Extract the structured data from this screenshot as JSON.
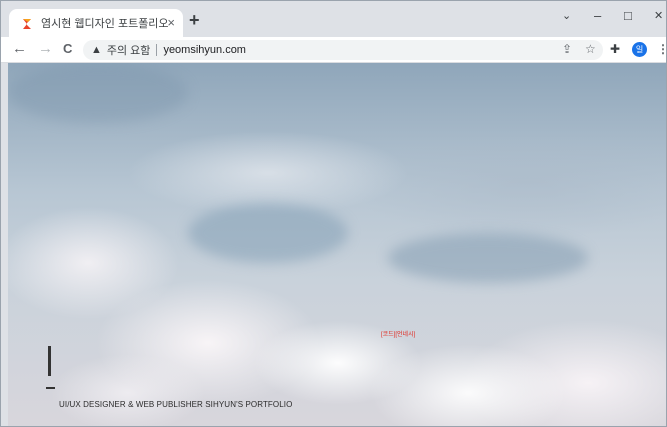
{
  "browser": {
    "tab": {
      "title": "염시현 웹디자인 포트폴리오",
      "close_icon": "×"
    },
    "new_tab_icon": "+",
    "window_controls": {
      "minimize": "–",
      "maximize": "□",
      "close": "✕",
      "tab_search": "⌄"
    },
    "nav": {
      "back": "←",
      "forward": "→",
      "reload": "C"
    },
    "omnibox": {
      "security_icon": "▲",
      "security_text": "주의 요함",
      "url": "yeomsihyun.com"
    },
    "toolbar_icons": {
      "share": "⇪",
      "bookmark": "☆",
      "extensions": "✚",
      "menu": "⋮"
    },
    "profile_initial": "일"
  },
  "page": {
    "center_label": "[코드][언네시]",
    "main_bar": "|",
    "subtitle": "UI/UX DESIGNER & WEB PUBLISHER SIHYUN'S PORTFOLIO"
  },
  "colors": {
    "accent_red": "#e0281e",
    "profile_blue": "#1a73e8"
  }
}
